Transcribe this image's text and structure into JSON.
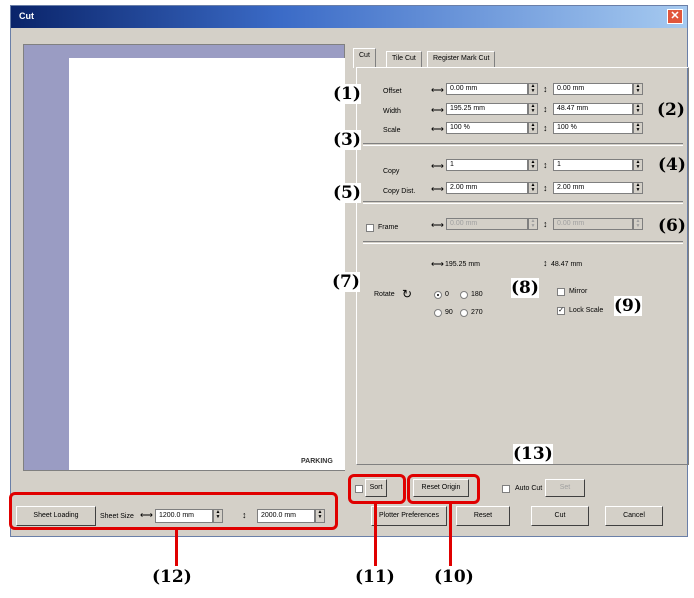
{
  "window": {
    "title": "Cut",
    "close_icon": "close-icon"
  },
  "preview": {
    "watermark": "PARKING"
  },
  "tabs": [
    "Cut",
    "Tile Cut",
    "Register Mark Cut"
  ],
  "offset": {
    "label": "Offset",
    "h_value": "0.00 mm",
    "v_value": "0.00 mm"
  },
  "width": {
    "label": "Width",
    "h_value": "195.25 mm",
    "v_value": "48.47 mm"
  },
  "scale": {
    "label": "Scale",
    "h_value": "100 %",
    "v_value": "100 %"
  },
  "copy": {
    "label": "Copy",
    "h_value": "1",
    "v_value": "1"
  },
  "copy_dist": {
    "label": "Copy Dist.",
    "h_value": "2.00 mm",
    "v_value": "2.00 mm"
  },
  "frame": {
    "label": "Frame",
    "h_value": "0.00 mm",
    "v_value": "0.00 mm"
  },
  "size_readout": {
    "h": "195.25 mm",
    "v": "48.47 mm"
  },
  "rotate": {
    "label": "Rotate",
    "options": [
      "0",
      "180",
      "90",
      "270"
    ],
    "selected": "0"
  },
  "mirror": {
    "label": "Mirror",
    "checked": false
  },
  "lock_scale": {
    "label": "Lock Scale",
    "checked": true
  },
  "bottom": {
    "sort_label": "Sort",
    "reset_origin": "Reset Origin",
    "auto_cut": "Auto Cut",
    "set_button": "Set",
    "sheet_loading": "Sheet Loading",
    "sheet_size_label": "Sheet Size",
    "sheet_w": "1200.0 mm",
    "sheet_h": "2000.0 mm",
    "plotter_prefs": "Plotter Preferences",
    "reset": "Reset",
    "cut": "Cut",
    "cancel": "Cancel"
  },
  "annotations": [
    "(1)",
    "(2)",
    "(3)",
    "(4)",
    "(5)",
    "(6)",
    "(7)",
    "(8)",
    "(9)",
    "(10)",
    "(11)",
    "(12)",
    "(13)"
  ],
  "colors": {
    "annotation_red": "#e00000",
    "title_blue": "#0a246a",
    "window_bg": "#d4d0c8",
    "preview_bg": "#9a9cc3"
  }
}
